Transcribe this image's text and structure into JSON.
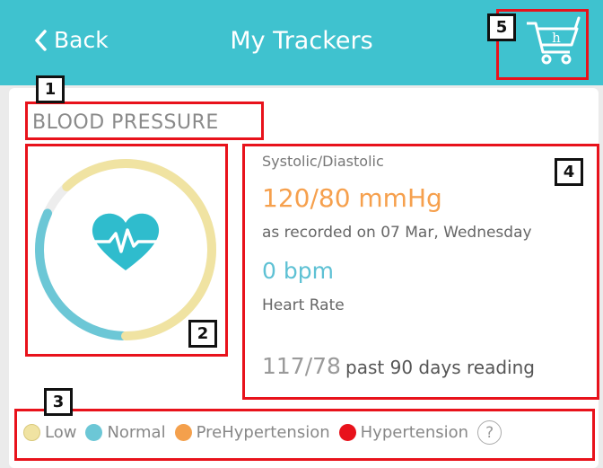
{
  "header": {
    "back_label": "Back",
    "title": "My Trackers",
    "cart_icon_letter": "h"
  },
  "tracker": {
    "title": "BLOOD PRESSURE",
    "metric_label": "Systolic/Diastolic",
    "bp_value": "120/80 mmHg",
    "recorded": "as recorded on 07 Mar, Wednesday",
    "hr_value": "0 bpm",
    "hr_label": "Heart Rate",
    "avg_value": "117/78",
    "avg_label": "past 90 days reading",
    "gauge_fraction": 0.62
  },
  "legend": {
    "items": [
      {
        "label": "Low",
        "color": "#f0e3a2"
      },
      {
        "label": "Normal",
        "color": "#6cc7d6"
      },
      {
        "label": "PreHypertension",
        "color": "#f4a04c"
      },
      {
        "label": "Hypertension",
        "color": "#e8121b"
      }
    ],
    "help": "?"
  },
  "annotations": [
    "1",
    "2",
    "3",
    "4",
    "5"
  ],
  "colors": {
    "header": "#3fc2cf",
    "heart": "#2fbccd",
    "annotation_box": "#e8121b"
  }
}
